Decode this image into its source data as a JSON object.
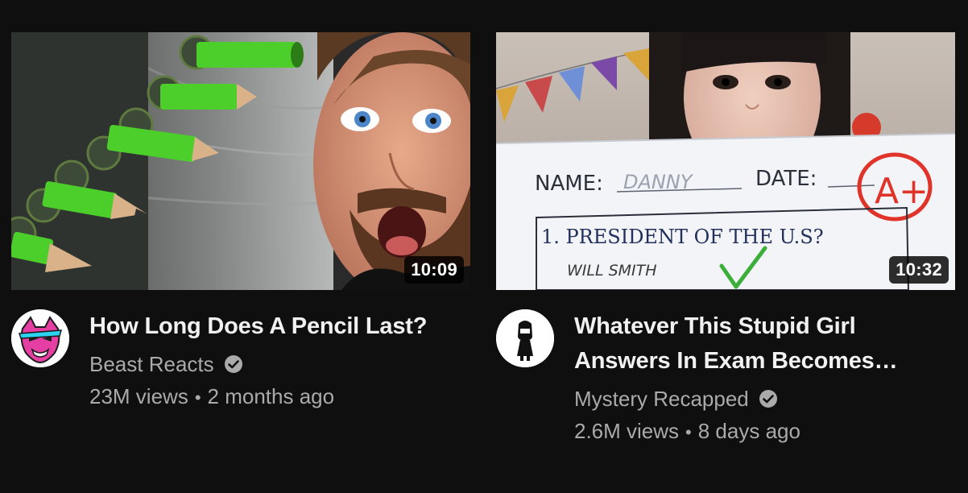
{
  "videos": [
    {
      "title": "How Long Does A Pencil Last?",
      "duration": "10:09",
      "channel": "Beast Reacts",
      "verified": true,
      "views": "23M views",
      "age": "2 months ago",
      "thumbnail_text": {}
    },
    {
      "title": "Whatever This Stupid Girl Answers In Exam Becomes…",
      "duration": "10:32",
      "channel": "Mystery Recapped",
      "verified": true,
      "views": "2.6M views",
      "age": "8 days ago",
      "thumbnail_text": {
        "name_label": "NAME:",
        "name_value": "DANNY",
        "date_label": "DATE:",
        "grade": "A+",
        "question": "1. PRESIDENT OF THE U.S?",
        "answer": "WILL SMITH"
      }
    }
  ],
  "colors": {
    "background": "#0f0f0f",
    "title": "#f1f1f1",
    "secondary": "#aaaaaa",
    "pencil_green": "#4ccf2a",
    "avatar_pink": "#e63fa3",
    "grade_red": "#e0332a",
    "check_green": "#3cae3a"
  }
}
